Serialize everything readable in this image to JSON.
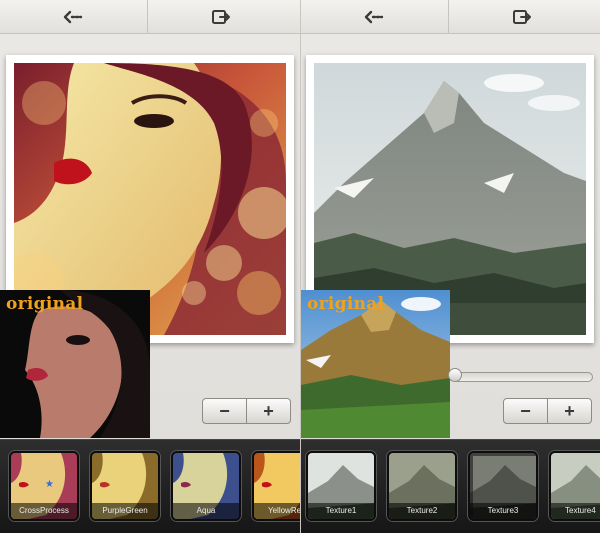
{
  "screens": [
    {
      "id": "left",
      "topbar": {
        "back_icon": "back-arrow-icon",
        "export_icon": "export-icon"
      },
      "original_label": "original",
      "stepper": {
        "minus_label": "−",
        "plus_label": "+"
      },
      "filters": [
        {
          "label": "CrossProcess",
          "selected": true
        },
        {
          "label": "PurpleGreen",
          "selected": false
        },
        {
          "label": "Aqua",
          "selected": false
        },
        {
          "label": "YellowRe",
          "selected": false
        }
      ]
    },
    {
      "id": "right",
      "topbar": {
        "back_icon": "back-arrow-icon",
        "export_icon": "export-icon"
      },
      "original_label": "original",
      "slider_value": 0,
      "stepper": {
        "minus_label": "−",
        "plus_label": "+"
      },
      "filters": [
        {
          "label": "Texture1",
          "selected": true
        },
        {
          "label": "Texture2",
          "selected": false
        },
        {
          "label": "Texture3",
          "selected": false
        },
        {
          "label": "Texture4",
          "selected": false
        }
      ]
    }
  ],
  "colors": {
    "original_label": "#f0a21c",
    "selected_star": "#2f6ce5",
    "filter_strip": "#1f1f1f"
  }
}
